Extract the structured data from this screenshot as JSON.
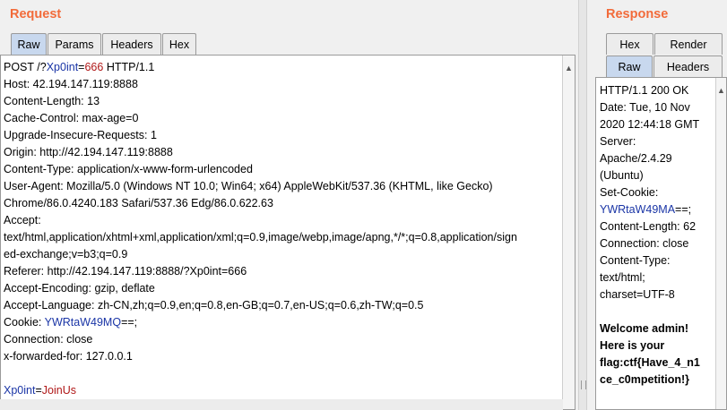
{
  "request": {
    "title": "Request",
    "tabs": [
      "Raw",
      "Params",
      "Headers",
      "Hex"
    ],
    "lines": [
      {
        "segs": [
          {
            "t": "POST /?"
          },
          {
            "t": "Xp0int",
            "c": "k"
          },
          {
            "t": "="
          },
          {
            "t": "666",
            "c": "v"
          },
          {
            "t": " HTTP/1.1"
          }
        ]
      },
      {
        "segs": [
          {
            "t": "Host: 42.194.147.119:8888"
          }
        ]
      },
      {
        "segs": [
          {
            "t": "Content-Length: 13"
          }
        ]
      },
      {
        "segs": [
          {
            "t": "Cache-Control: max-age=0"
          }
        ]
      },
      {
        "segs": [
          {
            "t": "Upgrade-Insecure-Requests: 1"
          }
        ]
      },
      {
        "segs": [
          {
            "t": "Origin: http://42.194.147.119:8888"
          }
        ]
      },
      {
        "segs": [
          {
            "t": "Content-Type: application/x-www-form-urlencoded"
          }
        ]
      },
      {
        "segs": [
          {
            "t": "User-Agent: Mozilla/5.0 (Windows NT 10.0; Win64; x64) AppleWebKit/537.36 (KHTML, like Gecko)"
          }
        ]
      },
      {
        "segs": [
          {
            "t": "Chrome/86.0.4240.183 Safari/537.36 Edg/86.0.622.63"
          }
        ]
      },
      {
        "segs": [
          {
            "t": "Accept:"
          }
        ]
      },
      {
        "segs": [
          {
            "t": "text/html,application/xhtml+xml,application/xml;q=0.9,image/webp,image/apng,*/*;q=0.8,application/sign"
          }
        ]
      },
      {
        "segs": [
          {
            "t": "ed-exchange;v=b3;q=0.9"
          }
        ]
      },
      {
        "segs": [
          {
            "t": "Referer: http://42.194.147.119:8888/?Xp0int=666"
          }
        ]
      },
      {
        "segs": [
          {
            "t": "Accept-Encoding: gzip, deflate"
          }
        ]
      },
      {
        "segs": [
          {
            "t": "Accept-Language: zh-CN,zh;q=0.9,en;q=0.8,en-GB;q=0.7,en-US;q=0.6,zh-TW;q=0.5"
          }
        ]
      },
      {
        "segs": [
          {
            "t": "Cookie: "
          },
          {
            "t": "YWRtaW49MQ",
            "c": "k"
          },
          {
            "t": "==;"
          }
        ]
      },
      {
        "segs": [
          {
            "t": "Connection: close"
          }
        ]
      },
      {
        "segs": [
          {
            "t": "x-forwarded-for: 127.0.0.1"
          }
        ]
      },
      {
        "segs": [
          {
            "t": ""
          }
        ]
      },
      {
        "segs": [
          {
            "t": "Xp0int",
            "c": "k"
          },
          {
            "t": "="
          },
          {
            "t": "JoinUs",
            "c": "v"
          }
        ]
      }
    ]
  },
  "response": {
    "title": "Response",
    "tabs_row1": [
      "Hex",
      "Render"
    ],
    "tabs_row2": [
      "Raw",
      "Headers"
    ],
    "lines": [
      {
        "segs": [
          {
            "t": "HTTP/1.1 200 OK"
          }
        ]
      },
      {
        "segs": [
          {
            "t": "Date: Tue, 10 Nov"
          }
        ]
      },
      {
        "segs": [
          {
            "t": "2020 12:44:18 GMT"
          }
        ]
      },
      {
        "segs": [
          {
            "t": "Server:"
          }
        ]
      },
      {
        "segs": [
          {
            "t": "Apache/2.4.29"
          }
        ]
      },
      {
        "segs": [
          {
            "t": "(Ubuntu)"
          }
        ]
      },
      {
        "segs": [
          {
            "t": "Set-Cookie:"
          }
        ]
      },
      {
        "segs": [
          {
            "t": "YWRtaW49MA",
            "c": "k"
          },
          {
            "t": "==;"
          }
        ]
      },
      {
        "segs": [
          {
            "t": "Content-Length: 62"
          }
        ]
      },
      {
        "segs": [
          {
            "t": "Connection: close"
          }
        ]
      },
      {
        "segs": [
          {
            "t": "Content-Type:"
          }
        ]
      },
      {
        "segs": [
          {
            "t": "text/html;"
          }
        ]
      },
      {
        "segs": [
          {
            "t": "charset=UTF-8"
          }
        ]
      },
      {
        "segs": [
          {
            "t": ""
          }
        ]
      },
      {
        "segs": [
          {
            "t": "Welcome admin!",
            "c": "bold"
          }
        ]
      },
      {
        "segs": [
          {
            "t": "Here is your",
            "c": "bold"
          }
        ]
      },
      {
        "segs": [
          {
            "t": "flag:ctf{Have_4_n1",
            "c": "bold"
          }
        ]
      },
      {
        "segs": [
          {
            "t": "ce_c0mpetition!}",
            "c": "bold"
          }
        ]
      }
    ]
  },
  "icons": {
    "up": "▲",
    "down": "▼"
  }
}
